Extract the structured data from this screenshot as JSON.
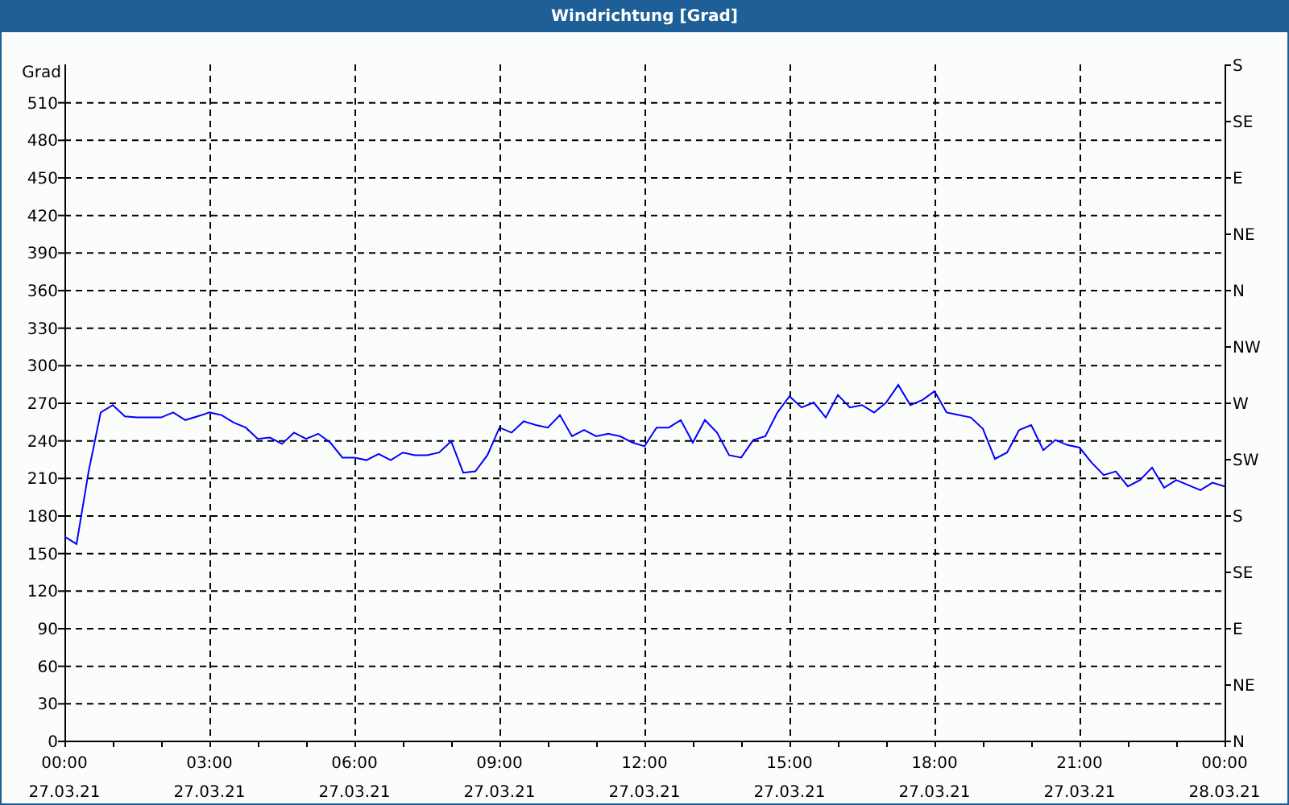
{
  "window": {
    "title": "Windrichtung [Grad]"
  },
  "chart": {
    "chart_data": {
      "type": "line",
      "grid": true,
      "ylabel": "Grad",
      "ylim": [
        0,
        540
      ],
      "yticks": [
        0,
        30,
        60,
        90,
        120,
        150,
        180,
        210,
        240,
        270,
        300,
        330,
        360,
        390,
        420,
        450,
        480,
        510
      ],
      "categories": [
        "00:00 27.03.21",
        null,
        null,
        null,
        null,
        null,
        null,
        null,
        null,
        null,
        null,
        null,
        "03:00 27.03.21",
        null,
        null,
        null,
        null,
        null,
        null,
        null,
        null,
        null,
        null,
        null,
        "06:00 27.03.21",
        null,
        null,
        null,
        null,
        null,
        null,
        null,
        null,
        null,
        null,
        null,
        "09:00 27.03.21",
        null,
        null,
        null,
        null,
        null,
        null,
        null,
        null,
        null,
        null,
        null,
        "12:00 27.03.21",
        null,
        null,
        null,
        null,
        null,
        null,
        null,
        null,
        null,
        null,
        null,
        "15:00 27.03.21",
        null,
        null,
        null,
        null,
        null,
        null,
        null,
        null,
        null,
        null,
        null,
        "18:00 27.03.21",
        null,
        null,
        null,
        null,
        null,
        null,
        null,
        null,
        null,
        null,
        null,
        "21:00 27.03.21",
        null,
        null,
        null,
        null,
        null,
        null,
        null,
        null,
        null,
        null,
        null,
        "00:00 28.03.21"
      ],
      "series": [
        {
          "color": "#0000ff",
          "values": [
            163,
            157,
            215,
            262,
            268,
            259,
            258,
            258,
            258,
            262,
            256,
            259,
            262,
            260,
            254,
            250,
            241,
            242,
            237,
            246,
            241,
            245,
            238,
            226,
            226,
            224,
            229,
            224,
            230,
            228,
            228,
            230,
            239,
            214,
            215,
            228,
            250,
            246,
            255,
            252,
            250,
            260,
            243,
            248,
            243,
            245,
            243,
            238,
            235,
            250,
            250,
            256,
            238,
            256,
            246,
            228,
            226,
            240,
            243,
            262,
            275,
            266,
            270,
            258,
            276,
            266,
            268,
            262,
            270,
            284,
            268,
            272,
            279,
            262,
            260,
            258,
            249,
            225,
            230,
            248,
            252,
            232,
            240,
            236,
            234,
            222,
            212,
            215,
            203,
            208,
            218,
            202,
            208,
            204,
            200,
            206,
            203
          ]
        }
      ]
    },
    "right_axis_labels": [
      "S",
      "SE",
      "E",
      "NE",
      "N",
      "NW",
      "W",
      "SW",
      "S",
      "SE",
      "E",
      "NE",
      "N"
    ]
  }
}
